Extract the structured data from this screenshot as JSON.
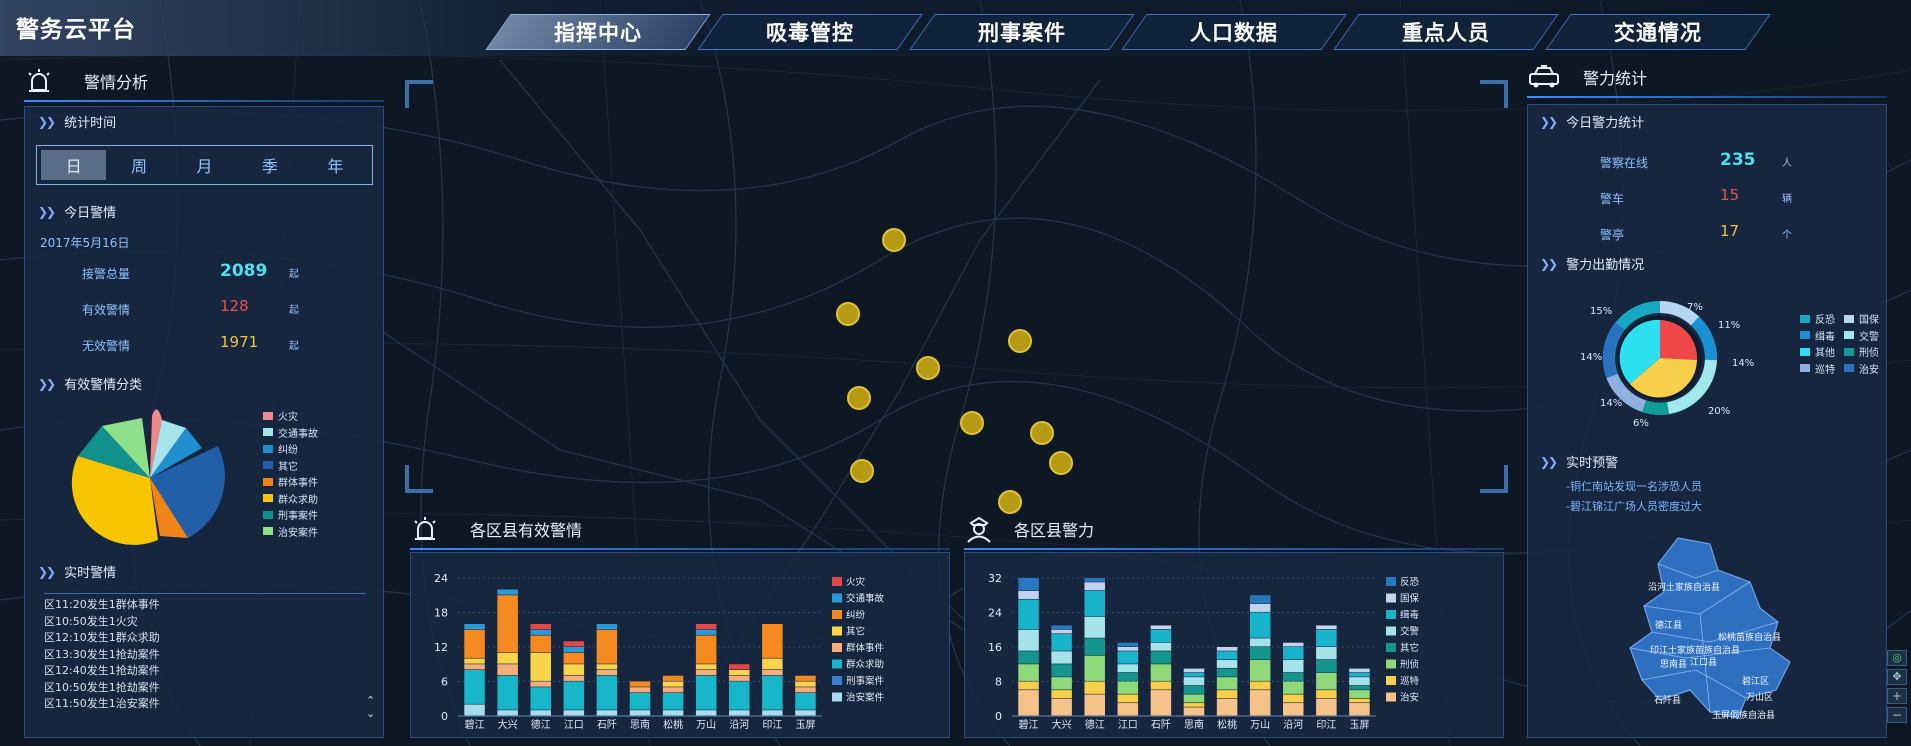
{
  "header": {
    "title": "警务云平台",
    "tabs": [
      {
        "label": "指挥中心",
        "active": true
      },
      {
        "label": "吸毒管控"
      },
      {
        "label": "刑事案件"
      },
      {
        "label": "人口数据"
      },
      {
        "label": "重点人员"
      },
      {
        "label": "交通情况"
      }
    ]
  },
  "left": {
    "title": "警情分析",
    "stat_time": {
      "label": "统计时间",
      "tabs": [
        "日",
        "周",
        "月",
        "季",
        "年"
      ],
      "active": "日"
    },
    "today": {
      "label": "今日警情",
      "date": "2017年5月16日",
      "rows": [
        {
          "label": "接警总量",
          "value": "2089",
          "unit": "起",
          "color": "#4fe0f0"
        },
        {
          "label": "有效警情",
          "value": "128",
          "unit": "起",
          "color": "#e8504c"
        },
        {
          "label": "无效警情",
          "value": "1971",
          "unit": "起",
          "color": "#f0c040"
        }
      ]
    },
    "category": {
      "label": "有效警情分类",
      "legend": [
        {
          "name": "火灾",
          "color": "#f08a8a"
        },
        {
          "name": "交通事故",
          "color": "#a6e3ec"
        },
        {
          "name": "纠纷",
          "color": "#1f8fd0"
        },
        {
          "name": "其它",
          "color": "#2160a8"
        },
        {
          "name": "群体事件",
          "color": "#f08418"
        },
        {
          "name": "群众求助",
          "color": "#f7c400"
        },
        {
          "name": "刑事案件",
          "color": "#12918c"
        },
        {
          "name": "治安案件",
          "color": "#8fe08a"
        }
      ]
    },
    "realtime": {
      "label": "实时警情",
      "items": [
        "区11:20发生1群体事件",
        "区10:50发生1火灾",
        "区12:10发生1群众求助",
        "区13:30发生1抢劫案件",
        "区12:40发生1抢劫案件",
        "区10:50发生1抢劫案件",
        "区11:50发生1治安案件"
      ]
    }
  },
  "right": {
    "title": "警力统计",
    "today": {
      "label": "今日警力统计",
      "rows": [
        {
          "label": "警察在线",
          "value": "235",
          "unit": "人",
          "color": "#4fe0f0"
        },
        {
          "label": "警车",
          "value": "15",
          "unit": "辆",
          "color": "#e8504c"
        },
        {
          "label": "警亭",
          "value": "17",
          "unit": "个",
          "color": "#f0c040"
        }
      ]
    },
    "duty": {
      "label": "警力出勤情况",
      "pcts": [
        "7%",
        "11%",
        "14%",
        "20%",
        "6%",
        "14%",
        "14%",
        "15%"
      ],
      "legend": [
        {
          "name": "反恐",
          "color": "#17a8c4"
        },
        {
          "name": "国保",
          "color": "#b7d4f0"
        },
        {
          "name": "缉毒",
          "color": "#1b8fd4"
        },
        {
          "name": "交警",
          "color": "#a0e8ee"
        },
        {
          "name": "其他",
          "color": "#2de0f0"
        },
        {
          "name": "刑侦",
          "color": "#119c95"
        },
        {
          "name": "巡特",
          "color": "#8fb0e0"
        },
        {
          "name": "治安",
          "color": "#2a72c0"
        }
      ]
    },
    "alerts": {
      "label": "实时预警",
      "items": [
        "-铜仁南站发现一名涉恐人员",
        "-碧江锦江广场人员密度过大"
      ]
    },
    "map_labels": [
      "沿河土家族自治县",
      "德江县",
      "松桃苗族自治县",
      "印江土家族苗族自治县",
      "思南县",
      "江口县",
      "碧江区",
      "石阡县",
      "万山区",
      "玉屏侗族自治县"
    ]
  },
  "bottom_left": {
    "title": "各区县有效警情"
  },
  "bottom_right": {
    "title": "各区县警力"
  },
  "chart_data": [
    {
      "type": "bar",
      "title": "各区县有效警情",
      "ylim": [
        0,
        24
      ],
      "yticks": [
        "0",
        "6",
        "12",
        "18",
        "24"
      ],
      "categories": [
        "碧江",
        "大兴",
        "德江",
        "江口",
        "石阡",
        "思南",
        "松桃",
        "万山",
        "沿河",
        "印江",
        "玉屏"
      ],
      "series": [
        {
          "name": "治安案件",
          "color": "#a6dcee",
          "values": [
            2,
            1,
            1,
            1,
            1,
            1,
            1,
            1,
            1,
            1,
            1
          ]
        },
        {
          "name": "刑事案件",
          "color": "#3a7fcf",
          "values": [
            0,
            0,
            0,
            0,
            0,
            0,
            0,
            0,
            0,
            0,
            0
          ]
        },
        {
          "name": "群众求助",
          "color": "#17b6c9",
          "values": [
            6,
            6,
            4,
            5,
            6,
            3,
            3,
            6,
            5,
            6,
            3
          ]
        },
        {
          "name": "群体事件",
          "color": "#f5ad7a",
          "values": [
            1,
            2,
            1,
            1,
            1,
            1,
            1,
            1,
            1,
            1,
            1
          ]
        },
        {
          "name": "其它",
          "color": "#f7d44a",
          "values": [
            1,
            2,
            5,
            2,
            1,
            0,
            1,
            1,
            1,
            2,
            1
          ]
        },
        {
          "name": "纠纷",
          "color": "#f58a20",
          "values": [
            5,
            10,
            3,
            2,
            6,
            1,
            1,
            5,
            0,
            6,
            1
          ]
        },
        {
          "name": "交通事故",
          "color": "#2a9ad6",
          "values": [
            1,
            1,
            1,
            1,
            1,
            0,
            0,
            1,
            0,
            0,
            0
          ]
        },
        {
          "name": "火灾",
          "color": "#e04848",
          "values": [
            0,
            0,
            1,
            1,
            0,
            0,
            0,
            1,
            1,
            0,
            0
          ]
        }
      ]
    },
    {
      "type": "bar",
      "title": "各区县警力",
      "ylim": [
        0,
        32
      ],
      "yticks": [
        "0",
        "8",
        "16",
        "24",
        "32"
      ],
      "categories": [
        "碧江",
        "大兴",
        "德江",
        "江口",
        "石阡",
        "思南",
        "松桃",
        "万山",
        "沿河",
        "印江",
        "玉屏"
      ],
      "series": [
        {
          "name": "治安",
          "color": "#f5c28a",
          "values": [
            6,
            4,
            5,
            3,
            6,
            2,
            4,
            6,
            3,
            4,
            3
          ]
        },
        {
          "name": "巡特",
          "color": "#f7cf4a",
          "values": [
            2,
            2,
            3,
            2,
            2,
            1,
            2,
            2,
            2,
            2,
            1
          ]
        },
        {
          "name": "刑侦",
          "color": "#8fd97a",
          "values": [
            4,
            3,
            6,
            3,
            4,
            2,
            3,
            5,
            3,
            4,
            2
          ]
        },
        {
          "name": "其它",
          "color": "#14968f",
          "values": [
            3,
            3,
            4,
            2,
            3,
            2,
            2,
            3,
            2,
            3,
            1
          ]
        },
        {
          "name": "交警",
          "color": "#a5e3ea",
          "values": [
            5,
            3,
            5,
            2,
            2,
            2,
            2,
            2,
            3,
            3,
            2
          ]
        },
        {
          "name": "缉毒",
          "color": "#18b4cc",
          "values": [
            7,
            4,
            6,
            3,
            3,
            1,
            2,
            6,
            3,
            4,
            1
          ]
        },
        {
          "name": "国保",
          "color": "#c0d4ee",
          "values": [
            2,
            1,
            2,
            1,
            1,
            1,
            1,
            2,
            1,
            1,
            1
          ]
        },
        {
          "name": "反恐",
          "color": "#2878c0",
          "values": [
            3,
            1,
            1,
            1,
            0,
            0,
            0,
            2,
            0,
            0,
            0
          ]
        }
      ]
    }
  ]
}
